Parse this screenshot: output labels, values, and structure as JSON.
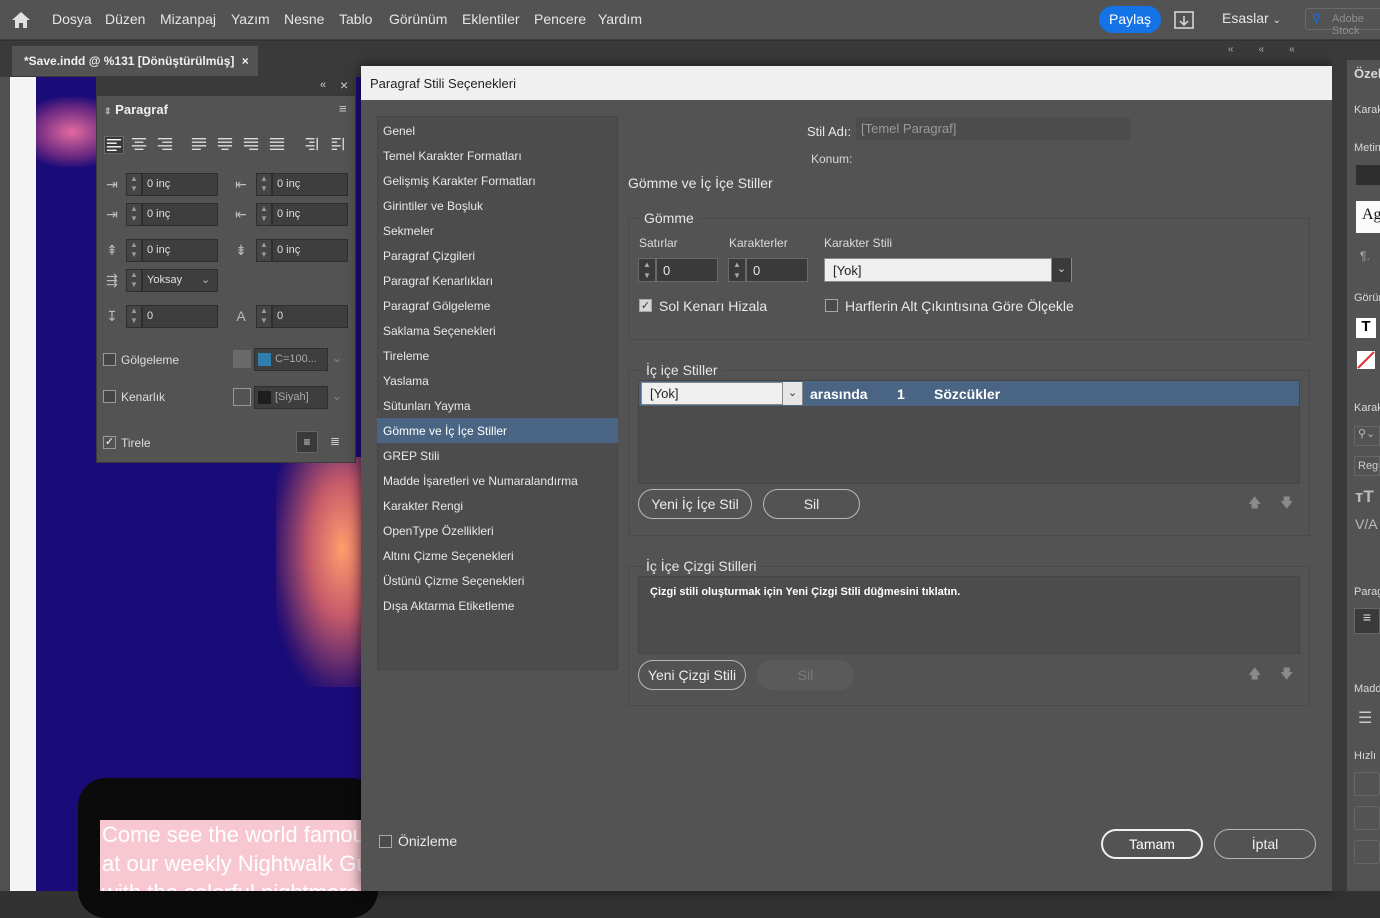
{
  "menubar": {
    "items": [
      "Dosya",
      "Düzen",
      "Mizanpaj",
      "Yazım",
      "Nesne",
      "Tablo",
      "Görünüm",
      "Eklentiler",
      "Pencere",
      "Yardım"
    ],
    "share_label": "Paylaş",
    "workspace_label": "Esaslar",
    "search_placeholder": "Adobe Stock"
  },
  "document_tab": {
    "title": "*Save.indd @ %131 [Dönüştürülmüş]",
    "close": "×"
  },
  "canvas": {
    "promo_text": [
      "Come see the world famous",
      "at our weekly Nightwalk Gu",
      "with the colorful nightmare"
    ]
  },
  "paragraph_panel": {
    "title": "Paragraf",
    "left_indent": "0 inç",
    "right_indent": "0 inç",
    "first_line_indent": "0 inç",
    "last_line_indent": "0 inç",
    "space_before": "0 inç",
    "space_after": "0 inç",
    "align_to_grid": "Yoksay",
    "drop_cap_lines": "0",
    "drop_cap_chars": "0",
    "shading_label": "Gölgeleme",
    "shading_color": "C=100...",
    "shading_swatch": "#2f7fae",
    "border_label": "Kenarlık",
    "border_color": "[Siyah]",
    "border_swatch": "#1e1e1e",
    "hyphenate_label": "Tirele",
    "hyphenate_checked": true,
    "close": "×",
    "collapse": "«",
    "menu": "≡"
  },
  "dialog": {
    "title": "Paragraf Stili Seçenekleri",
    "categories": [
      "Genel",
      "Temel Karakter Formatları",
      "Gelişmiş Karakter Formatları",
      "Girintiler ve Boşluk",
      "Sekmeler",
      "Paragraf Çizgileri",
      "Paragraf Kenarlıkları",
      "Paragraf Gölgeleme",
      "Saklama Seçenekleri",
      "Tireleme",
      "Yaslama",
      "Sütunları Yayma",
      "Gömme ve İç İçe Stiller",
      "GREP Stili",
      "Madde İşaretleri ve Numaralandırma",
      "Karakter Rengi",
      "OpenType Özellikleri",
      "Altını Çizme Seçenekleri",
      "Üstünü Çizme Seçenekleri",
      "Dışa Aktarma Etiketleme"
    ],
    "selected_category": "Gömme ve İç İçe Stiller",
    "style_name_label": "Stil Adı:",
    "style_name_value": "[Temel Paragraf]",
    "location_label": "Konum:",
    "section_title": "Gömme ve İç İçe Stiller",
    "drop_caps": {
      "group_label": "Gömme",
      "lines_label": "Satırlar",
      "lines_value": "0",
      "chars_label": "Karakterler",
      "chars_value": "0",
      "char_style_label": "Karakter Stili",
      "char_style_value": "[Yok]",
      "align_left_label": "Sol Kenarı Hizala",
      "align_left_checked": true,
      "scale_descenders_label": "Harflerin Alt Çıkıntısına Göre Ölçekle",
      "scale_descenders_checked": false
    },
    "nested_styles": {
      "group_label": "İç içe Stiller",
      "rows": [
        {
          "style": "[Yok]",
          "relation": "arasında",
          "count": "1",
          "unit": "Sözcükler"
        }
      ],
      "new_button": "Yeni İç İçe Stil",
      "delete_button": "Sil"
    },
    "nested_line_styles": {
      "group_label": "İç İçe Çizgi Stilleri",
      "empty_message": "Çizgi stili oluşturmak için Yeni Çizgi Stili düğmesini tıklatın.",
      "new_button": "Yeni Çizgi Stili",
      "delete_button": "Sil"
    },
    "move_up": "🡅",
    "move_down": "🡇",
    "preview_label": "Önizleme",
    "ok_label": "Tamam",
    "cancel_label": "İptal"
  },
  "right_panel": {
    "labels": [
      "Özel",
      "Karak",
      "Metin",
      "Görün",
      "Karak",
      "Parag",
      "Madd",
      "Hızlı İ"
    ],
    "font_preview": "Ag",
    "font_style": "Regu"
  },
  "colors": {
    "accent": "#1473e6",
    "selection": "#4a6584",
    "artwork": "#1a0c78"
  }
}
